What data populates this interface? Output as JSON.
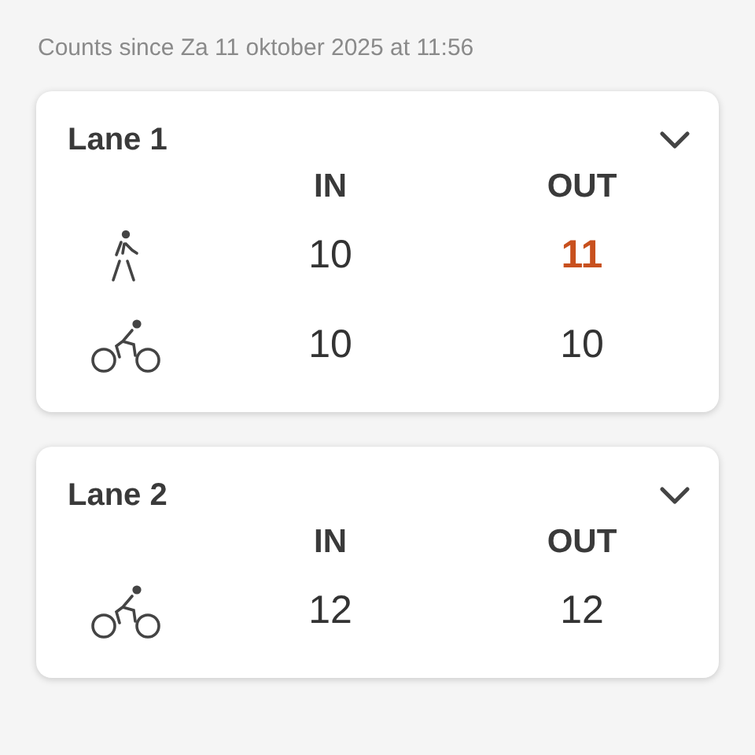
{
  "header": "Counts since Za 11 oktober 2025 at 11:56",
  "lanes": [
    {
      "title": "Lane 1",
      "expanded": true,
      "columns": [
        "IN",
        "OUT"
      ],
      "rows": [
        {
          "kind": "pedestrian",
          "in": "10",
          "out": "11",
          "out_highlight": true
        },
        {
          "kind": "bicycle",
          "in": "10",
          "out": "10",
          "out_highlight": false
        }
      ]
    },
    {
      "title": "Lane 2",
      "expanded": true,
      "columns": [
        "IN",
        "OUT"
      ],
      "rows": [
        {
          "kind": "bicycle",
          "in": "12",
          "out": "12",
          "out_highlight": false
        }
      ]
    }
  ]
}
